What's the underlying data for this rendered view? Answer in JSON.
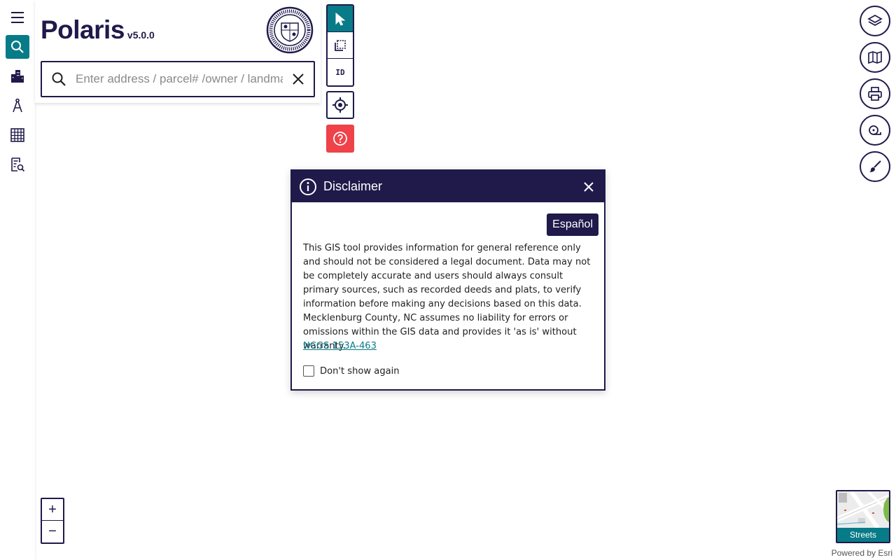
{
  "app": {
    "name": "Polaris",
    "version": "v5.0.0"
  },
  "rail": {
    "items": [
      {
        "name": "menu-icon",
        "active": false
      },
      {
        "name": "search-icon",
        "active": true
      },
      {
        "name": "buildings-icon",
        "active": false
      },
      {
        "name": "drafting-compass-icon",
        "active": false
      },
      {
        "name": "grid-table-icon",
        "active": false
      },
      {
        "name": "document-search-icon",
        "active": false
      }
    ]
  },
  "search": {
    "placeholder": "Enter address / parcel# /owner / landmark",
    "value": ""
  },
  "tools": {
    "items": [
      {
        "name": "select-pointer-icon",
        "active": true
      },
      {
        "name": "select-area-icon",
        "active": false
      },
      {
        "name": "identify-icon",
        "label": "ID",
        "active": false
      }
    ]
  },
  "right_buttons": [
    {
      "name": "layers-icon"
    },
    {
      "name": "map-icon"
    },
    {
      "name": "print-icon"
    },
    {
      "name": "measure-icon"
    },
    {
      "name": "draw-icon"
    }
  ],
  "dialog": {
    "title": "Disclaimer",
    "language_button": "Español",
    "body": "This GIS tool provides information for general reference only and should not be considered a legal document. Data may not be completely accurate and users should always consult primary sources, such as recorded deeds and plats, to verify information before making any decisions based on this data. Mecklenburg County, NC assumes no liability for errors or omissions within the GIS data and provides it 'as is' without warranty.",
    "link": "NCGS 153A-463",
    "checkbox_label": "Don't show again",
    "checkbox_checked": false
  },
  "zoom": {
    "in": "+",
    "out": "−"
  },
  "basemap": {
    "label": "Streets"
  },
  "attribution": "Powered by Esri",
  "colors": {
    "primary": "#1f1a4a",
    "accent": "#087b88",
    "danger": "#ef4249"
  }
}
